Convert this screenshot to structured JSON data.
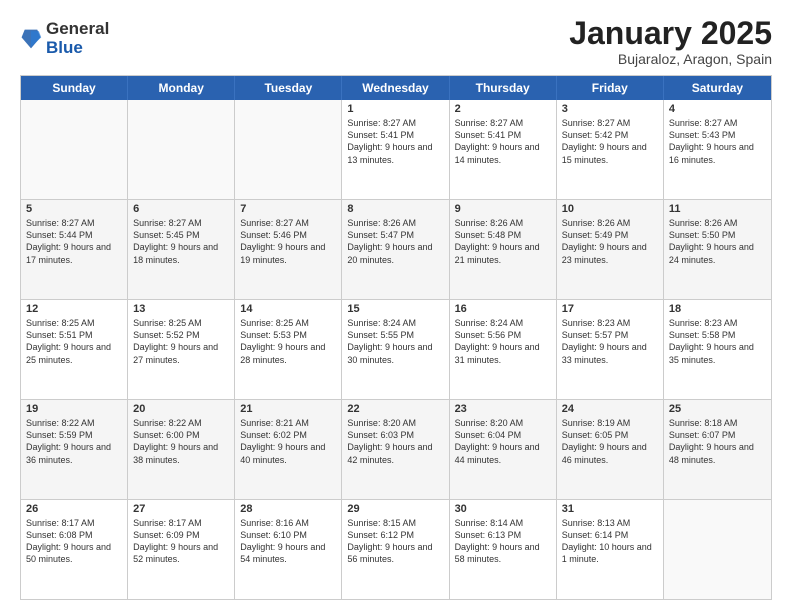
{
  "logo": {
    "general": "General",
    "blue": "Blue"
  },
  "title": "January 2025",
  "subtitle": "Bujaraloz, Aragon, Spain",
  "headers": [
    "Sunday",
    "Monday",
    "Tuesday",
    "Wednesday",
    "Thursday",
    "Friday",
    "Saturday"
  ],
  "weeks": [
    [
      {
        "date": "",
        "info": ""
      },
      {
        "date": "",
        "info": ""
      },
      {
        "date": "",
        "info": ""
      },
      {
        "date": "1",
        "info": "Sunrise: 8:27 AM\nSunset: 5:41 PM\nDaylight: 9 hours and 13 minutes."
      },
      {
        "date": "2",
        "info": "Sunrise: 8:27 AM\nSunset: 5:41 PM\nDaylight: 9 hours and 14 minutes."
      },
      {
        "date": "3",
        "info": "Sunrise: 8:27 AM\nSunset: 5:42 PM\nDaylight: 9 hours and 15 minutes."
      },
      {
        "date": "4",
        "info": "Sunrise: 8:27 AM\nSunset: 5:43 PM\nDaylight: 9 hours and 16 minutes."
      }
    ],
    [
      {
        "date": "5",
        "info": "Sunrise: 8:27 AM\nSunset: 5:44 PM\nDaylight: 9 hours and 17 minutes."
      },
      {
        "date": "6",
        "info": "Sunrise: 8:27 AM\nSunset: 5:45 PM\nDaylight: 9 hours and 18 minutes."
      },
      {
        "date": "7",
        "info": "Sunrise: 8:27 AM\nSunset: 5:46 PM\nDaylight: 9 hours and 19 minutes."
      },
      {
        "date": "8",
        "info": "Sunrise: 8:26 AM\nSunset: 5:47 PM\nDaylight: 9 hours and 20 minutes."
      },
      {
        "date": "9",
        "info": "Sunrise: 8:26 AM\nSunset: 5:48 PM\nDaylight: 9 hours and 21 minutes."
      },
      {
        "date": "10",
        "info": "Sunrise: 8:26 AM\nSunset: 5:49 PM\nDaylight: 9 hours and 23 minutes."
      },
      {
        "date": "11",
        "info": "Sunrise: 8:26 AM\nSunset: 5:50 PM\nDaylight: 9 hours and 24 minutes."
      }
    ],
    [
      {
        "date": "12",
        "info": "Sunrise: 8:25 AM\nSunset: 5:51 PM\nDaylight: 9 hours and 25 minutes."
      },
      {
        "date": "13",
        "info": "Sunrise: 8:25 AM\nSunset: 5:52 PM\nDaylight: 9 hours and 27 minutes."
      },
      {
        "date": "14",
        "info": "Sunrise: 8:25 AM\nSunset: 5:53 PM\nDaylight: 9 hours and 28 minutes."
      },
      {
        "date": "15",
        "info": "Sunrise: 8:24 AM\nSunset: 5:55 PM\nDaylight: 9 hours and 30 minutes."
      },
      {
        "date": "16",
        "info": "Sunrise: 8:24 AM\nSunset: 5:56 PM\nDaylight: 9 hours and 31 minutes."
      },
      {
        "date": "17",
        "info": "Sunrise: 8:23 AM\nSunset: 5:57 PM\nDaylight: 9 hours and 33 minutes."
      },
      {
        "date": "18",
        "info": "Sunrise: 8:23 AM\nSunset: 5:58 PM\nDaylight: 9 hours and 35 minutes."
      }
    ],
    [
      {
        "date": "19",
        "info": "Sunrise: 8:22 AM\nSunset: 5:59 PM\nDaylight: 9 hours and 36 minutes."
      },
      {
        "date": "20",
        "info": "Sunrise: 8:22 AM\nSunset: 6:00 PM\nDaylight: 9 hours and 38 minutes."
      },
      {
        "date": "21",
        "info": "Sunrise: 8:21 AM\nSunset: 6:02 PM\nDaylight: 9 hours and 40 minutes."
      },
      {
        "date": "22",
        "info": "Sunrise: 8:20 AM\nSunset: 6:03 PM\nDaylight: 9 hours and 42 minutes."
      },
      {
        "date": "23",
        "info": "Sunrise: 8:20 AM\nSunset: 6:04 PM\nDaylight: 9 hours and 44 minutes."
      },
      {
        "date": "24",
        "info": "Sunrise: 8:19 AM\nSunset: 6:05 PM\nDaylight: 9 hours and 46 minutes."
      },
      {
        "date": "25",
        "info": "Sunrise: 8:18 AM\nSunset: 6:07 PM\nDaylight: 9 hours and 48 minutes."
      }
    ],
    [
      {
        "date": "26",
        "info": "Sunrise: 8:17 AM\nSunset: 6:08 PM\nDaylight: 9 hours and 50 minutes."
      },
      {
        "date": "27",
        "info": "Sunrise: 8:17 AM\nSunset: 6:09 PM\nDaylight: 9 hours and 52 minutes."
      },
      {
        "date": "28",
        "info": "Sunrise: 8:16 AM\nSunset: 6:10 PM\nDaylight: 9 hours and 54 minutes."
      },
      {
        "date": "29",
        "info": "Sunrise: 8:15 AM\nSunset: 6:12 PM\nDaylight: 9 hours and 56 minutes."
      },
      {
        "date": "30",
        "info": "Sunrise: 8:14 AM\nSunset: 6:13 PM\nDaylight: 9 hours and 58 minutes."
      },
      {
        "date": "31",
        "info": "Sunrise: 8:13 AM\nSunset: 6:14 PM\nDaylight: 10 hours and 1 minute."
      },
      {
        "date": "",
        "info": ""
      }
    ]
  ]
}
